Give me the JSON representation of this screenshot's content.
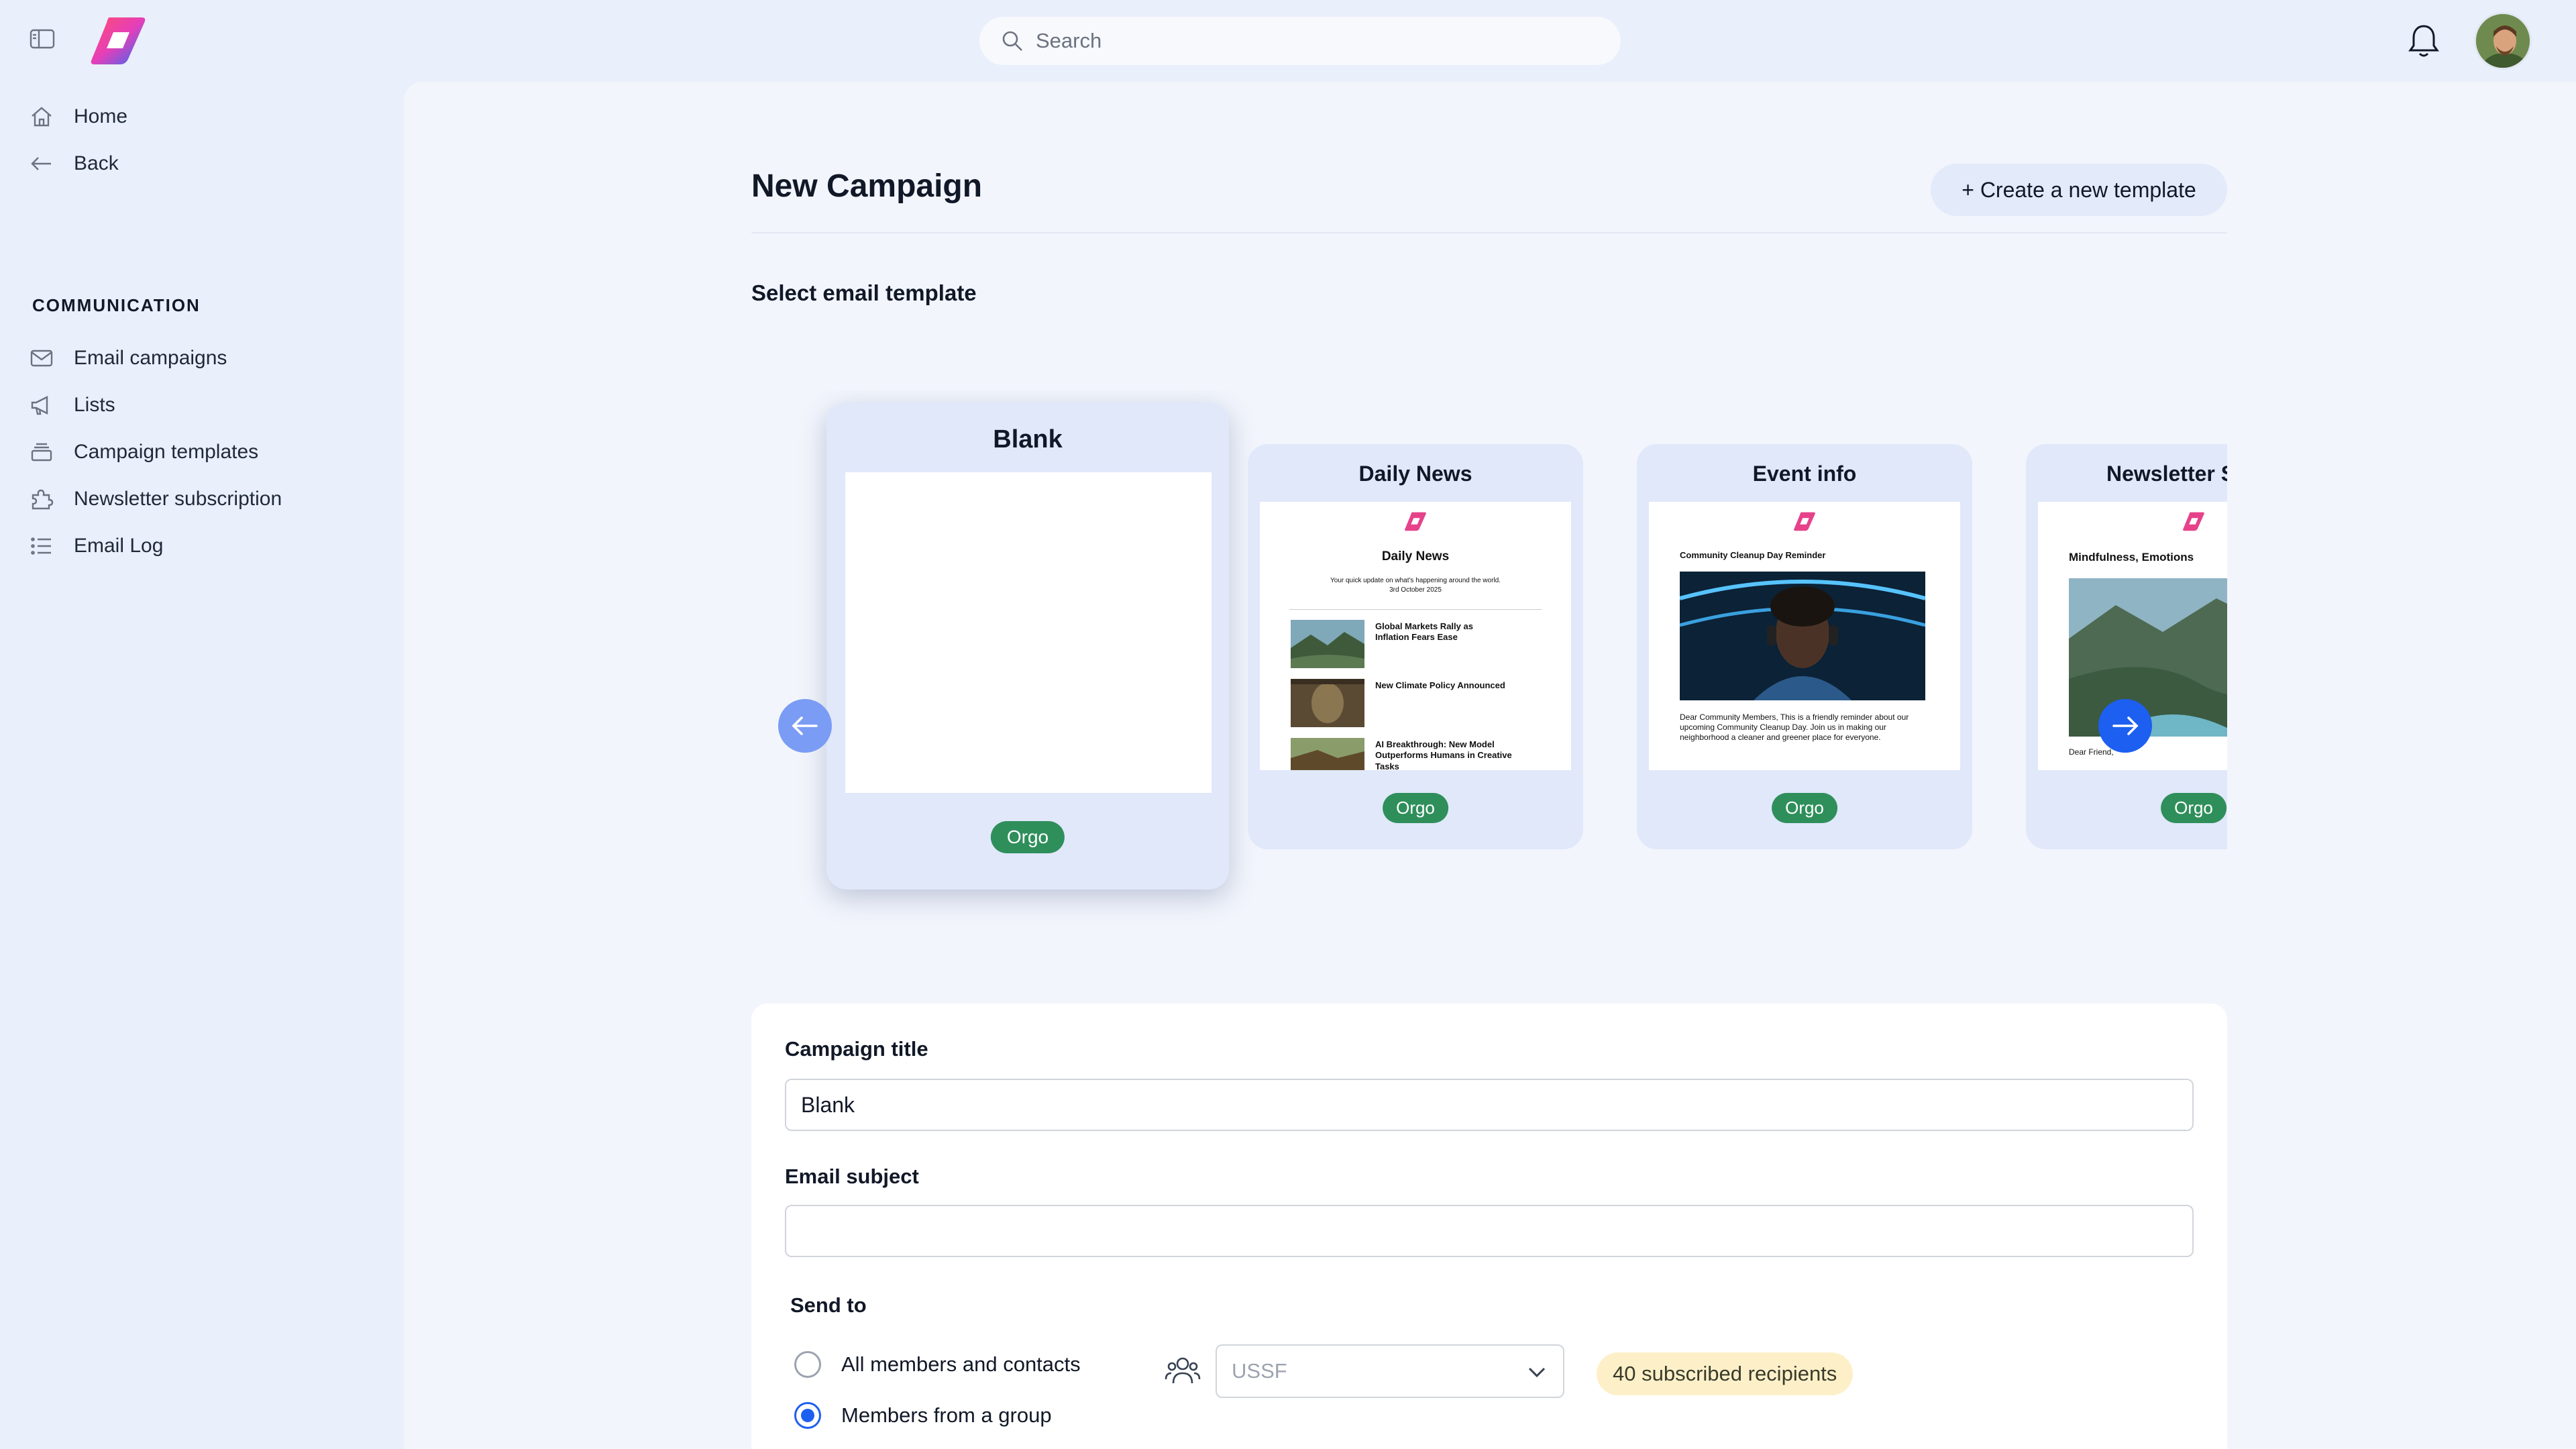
{
  "header": {
    "search_placeholder": "Search"
  },
  "sidebar": {
    "items": [
      {
        "label": "Home",
        "icon": "home-icon"
      },
      {
        "label": "Back",
        "icon": "arrow-left-icon"
      }
    ],
    "section_label": "COMMUNICATION",
    "section_items": [
      {
        "label": "Email campaigns",
        "icon": "mail-icon"
      },
      {
        "label": "Lists",
        "icon": "megaphone-icon"
      },
      {
        "label": "Campaign templates",
        "icon": "layers-icon"
      },
      {
        "label": "Newsletter subscription",
        "icon": "puzzle-icon"
      },
      {
        "label": "Email Log",
        "icon": "list-icon"
      }
    ]
  },
  "main": {
    "title": "New Campaign",
    "create_template_button": "+ Create a new template",
    "select_template_label": "Select email template",
    "templates": [
      {
        "title": "Blank",
        "badge": "Orgo",
        "selected": true
      },
      {
        "title": "Daily News",
        "badge": "Orgo",
        "preview": {
          "heading": "Daily News",
          "intro": "Your quick update on what's happening around the world.",
          "date": "3rd October 2025",
          "articles": [
            "Global Markets Rally as Inflation Fears Ease",
            "New Climate Policy Announced",
            "AI Breakthrough: New Model Outperforms Humans in Creative Tasks"
          ]
        }
      },
      {
        "title": "Event info",
        "badge": "Orgo",
        "preview": {
          "heading": "Community Cleanup Day Reminder",
          "body": "Dear Community Members, This is a friendly reminder about our upcoming Community Cleanup Day. Join us in making our neighborhood a cleaner and greener place for everyone."
        }
      },
      {
        "title": "Newsletter S",
        "badge": "Orgo",
        "preview": {
          "heading": "Mindfulness, Emotions",
          "greeting": "Dear Friend,"
        }
      }
    ]
  },
  "form": {
    "campaign_title_label": "Campaign title",
    "campaign_title_value": "Blank",
    "email_subject_label": "Email subject",
    "email_subject_value": "",
    "send_to_label": "Send to",
    "options": [
      {
        "label": "All members and contacts",
        "checked": false
      },
      {
        "label": "Members from a group",
        "checked": true
      }
    ],
    "group_select_value": "USSF",
    "recipients_badge": "40 subscribed recipients"
  },
  "colors": {
    "accent": "#1d5ff0",
    "badge_green": "#2f8f5b",
    "sidebar_bg": "#e9effb",
    "main_bg": "#f2f5fc",
    "recipients_bg": "#fdf0c9"
  }
}
